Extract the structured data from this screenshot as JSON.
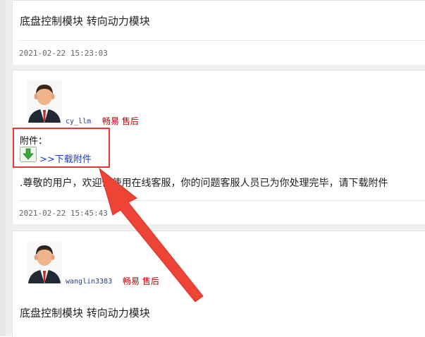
{
  "posts": [
    {
      "content": "底盘控制模块 转向动力模块",
      "timestamp": "2021-02-22 15:23:03"
    },
    {
      "username": "cy_llm",
      "role": "畅易 售后",
      "attachment_label": "附件：",
      "download_link": ">>下载附件",
      "message": ".尊敬的用户，欢迎你使用在线客服，你的问题客服人员已为你处理完毕，请下载附件",
      "timestamp": "2021-02-22 15:45:43"
    },
    {
      "username": "wanglin3383",
      "role": "畅易 售后",
      "content": "底盘控制模块 转向动力模块"
    }
  ],
  "icons": {
    "avatar": "customer-service-avatar-icon",
    "download": "download-arrow-icon"
  },
  "colors": {
    "role": "#c00000",
    "username": "#2a3a8c",
    "link": "#1a3cc9",
    "annotation": "#e53935"
  }
}
